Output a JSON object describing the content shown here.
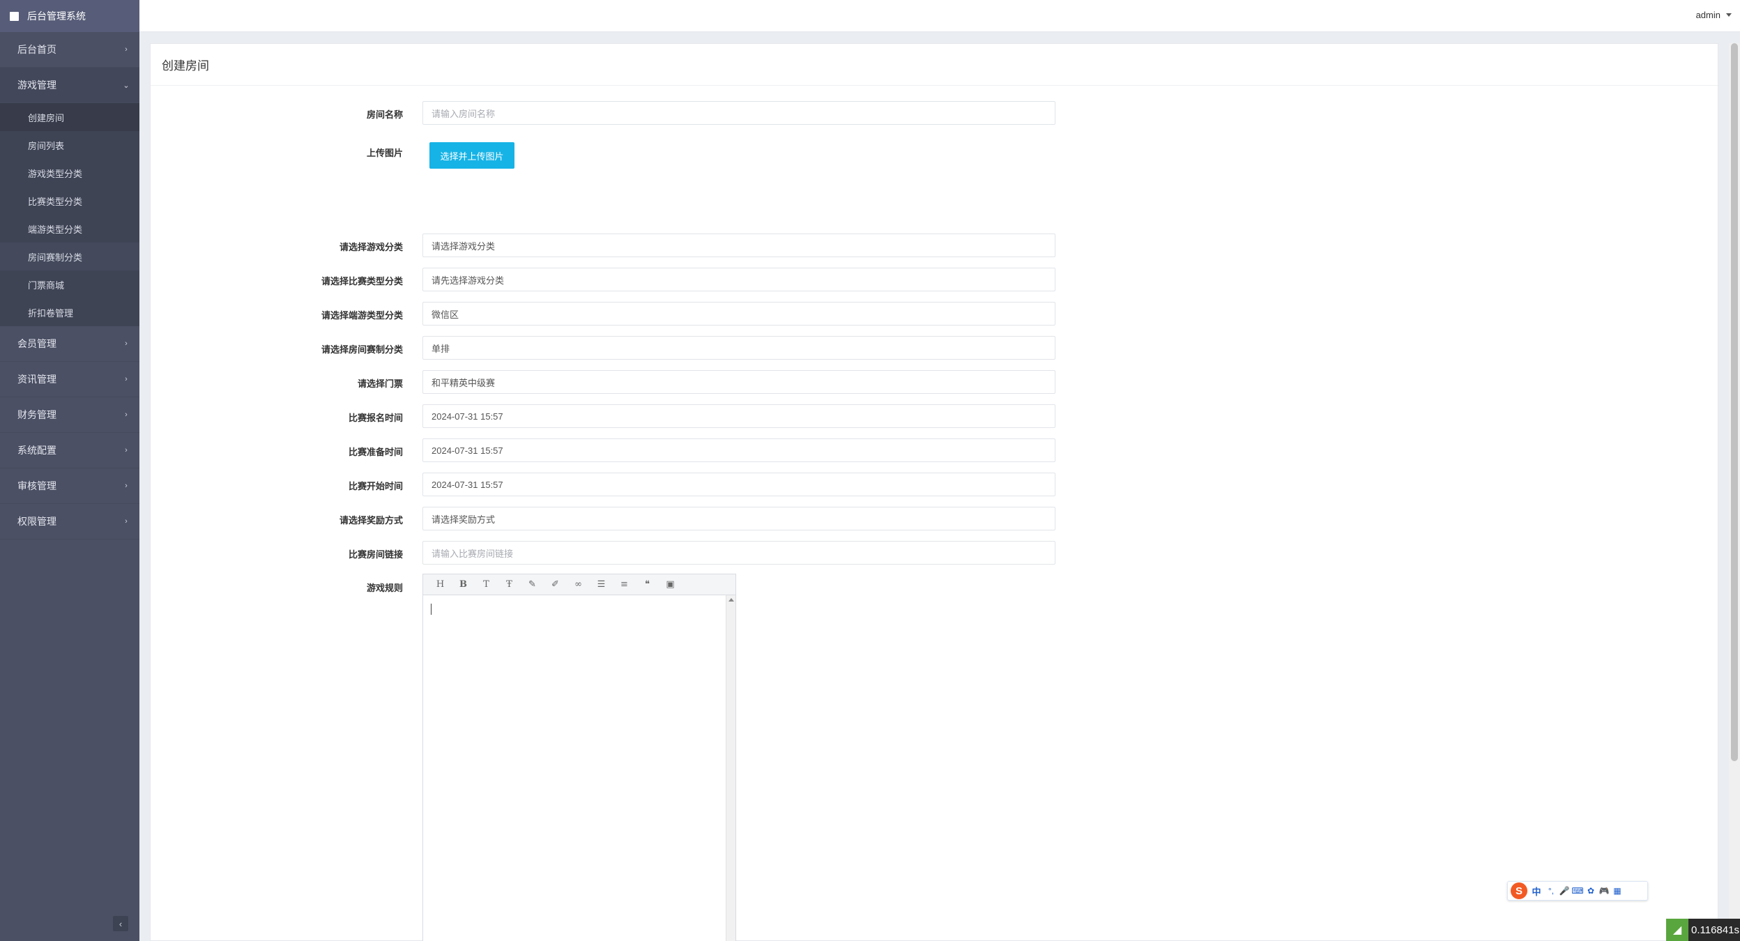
{
  "brand": {
    "title": "后台管理系统"
  },
  "topbar": {
    "user": "admin"
  },
  "sidebar": {
    "items": [
      {
        "label": "后台首页",
        "chevron": "›"
      },
      {
        "label": "游戏管理",
        "chevron": "⌄"
      },
      {
        "label": "会员管理",
        "chevron": "›"
      },
      {
        "label": "资讯管理",
        "chevron": "›"
      },
      {
        "label": "财务管理",
        "chevron": "›"
      },
      {
        "label": "系统配置",
        "chevron": "›"
      },
      {
        "label": "审核管理",
        "chevron": "›"
      },
      {
        "label": "权限管理",
        "chevron": "›"
      }
    ],
    "submenu": [
      {
        "label": "创建房间"
      },
      {
        "label": "房间列表"
      },
      {
        "label": "游戏类型分类"
      },
      {
        "label": "比赛类型分类"
      },
      {
        "label": "端游类型分类"
      },
      {
        "label": "房间赛制分类"
      },
      {
        "label": "门票商城"
      },
      {
        "label": "折扣卷管理"
      }
    ],
    "collapse": "‹"
  },
  "panel": {
    "title": "创建房间"
  },
  "form": {
    "room_name": {
      "label": "房间名称",
      "placeholder": "请输入房间名称"
    },
    "upload": {
      "label": "上传图片",
      "button": "选择并上传图片"
    },
    "game_cat": {
      "label": "请选择游戏分类",
      "value": "请选择游戏分类"
    },
    "match_cat": {
      "label": "请选择比赛类型分类",
      "value": "请先选择游戏分类"
    },
    "pc_cat": {
      "label": "请选择端游类型分类",
      "value": "微信区"
    },
    "format_cat": {
      "label": "请选择房间赛制分类",
      "value": "单排"
    },
    "ticket": {
      "label": "请选择门票",
      "value": "和平精英中级赛"
    },
    "signup_time": {
      "label": "比赛报名时间",
      "value": "2024-07-31 15:57"
    },
    "prep_time": {
      "label": "比赛准备时间",
      "value": "2024-07-31 15:57"
    },
    "start_time": {
      "label": "比赛开始时间",
      "value": "2024-07-31 15:57"
    },
    "reward": {
      "label": "请选择奖励方式",
      "value": "请选择奖励方式"
    },
    "link": {
      "label": "比赛房间链接",
      "placeholder": "请输入比赛房间链接"
    },
    "rules": {
      "label": "游戏规则"
    }
  },
  "editor": {
    "tools": [
      {
        "icon": "heading-icon",
        "glyph": "H"
      },
      {
        "icon": "bold-icon",
        "glyph": "B"
      },
      {
        "icon": "font-size-icon",
        "glyph": "T"
      },
      {
        "icon": "clear-format-icon",
        "glyph": "Ŧ"
      },
      {
        "icon": "highlight-icon",
        "glyph": "✎"
      },
      {
        "icon": "brush-icon",
        "glyph": "✐"
      },
      {
        "icon": "link-icon",
        "glyph": "∞"
      },
      {
        "icon": "list-icon",
        "glyph": "☰"
      },
      {
        "icon": "align-icon",
        "glyph": "≡"
      },
      {
        "icon": "quote-icon",
        "glyph": "❝"
      },
      {
        "icon": "image-icon",
        "glyph": "▣"
      }
    ]
  },
  "ime": {
    "logo": "S",
    "mode": "中",
    "punct": "°,",
    "mic": "🎤",
    "keyboard": "⌨",
    "skin": "✿",
    "game": "🎮",
    "apps": "▦"
  },
  "timer": {
    "value": "0.116841s",
    "leaf": "◢"
  }
}
